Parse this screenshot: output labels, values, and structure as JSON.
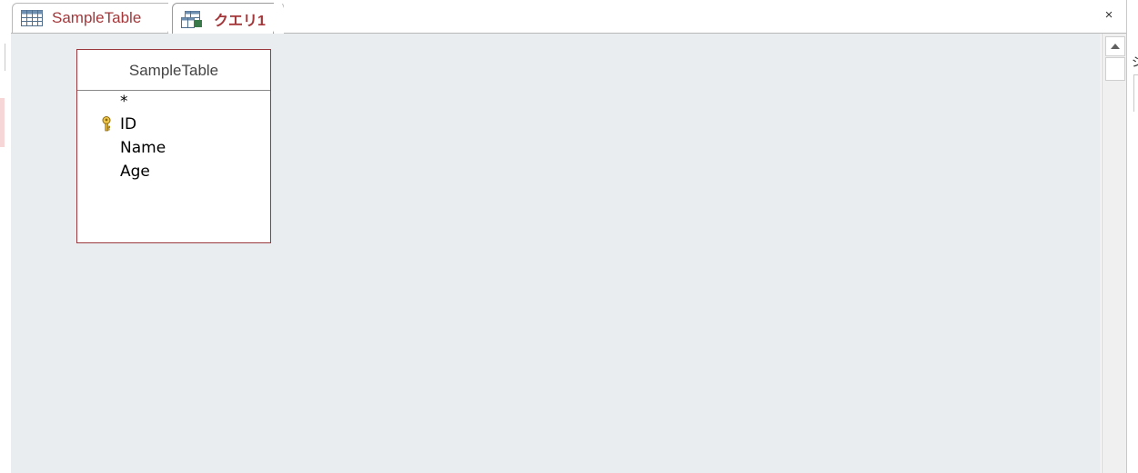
{
  "tabs": [
    {
      "label": "SampleTable",
      "icon": "table-icon",
      "active": false
    },
    {
      "label": "クエリ1",
      "icon": "query-icon",
      "active": true
    }
  ],
  "close_label": "×",
  "right_panel": {
    "cut_text": "ジ"
  },
  "field_list": {
    "title": "SampleTable",
    "fields": [
      {
        "name": "*",
        "is_key": false
      },
      {
        "name": "ID",
        "is_key": true
      },
      {
        "name": "Name",
        "is_key": false
      },
      {
        "name": "Age",
        "is_key": false
      }
    ]
  },
  "colors": {
    "accent": "#a4373a",
    "canvas": "#e9edf0",
    "field_list_border": "#9b3a3e"
  }
}
